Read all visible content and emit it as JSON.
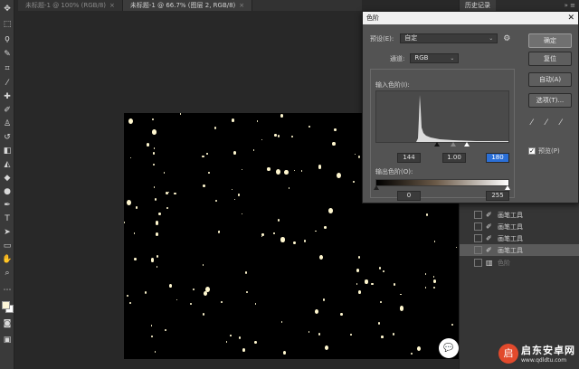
{
  "tabs": [
    {
      "label": "未标题-1 @ 100% (RGB/8)",
      "close": "×"
    },
    {
      "label": "未标题-1 @ 66.7% (图层 2, RGB/8)",
      "close": "×"
    }
  ],
  "history_panel": {
    "title": "历史记录",
    "controls": "»  ≡",
    "items": [
      {
        "label": "画笔工具"
      },
      {
        "label": "画笔工具"
      },
      {
        "label": "画笔工具"
      },
      {
        "label": "画笔工具"
      },
      {
        "label": "色阶"
      }
    ]
  },
  "levels_dialog": {
    "title": "色阶",
    "close": "✕",
    "preset_label": "预设(E):",
    "preset_value": "自定",
    "channel_label": "通道:",
    "channel_value": "RGB",
    "input_levels_label": "输入色阶(I):",
    "input_black": "144",
    "input_gamma": "1.00",
    "input_white": "180",
    "output_levels_label": "输出色阶(O):",
    "output_black": "0",
    "output_white": "255",
    "buttons": {
      "ok": "确定",
      "reset": "复位",
      "auto": "自动(A)",
      "options": "选项(T)..."
    },
    "preview_label": "预览(P)",
    "preview_checked": true
  },
  "watermark": {
    "main": "启东安卓网",
    "sub": "www.qdldtu.com"
  },
  "icons": {
    "gear": "gear-icon",
    "eyedropper": "eyedropper-icon",
    "brush": "brush-icon",
    "wechat": "wechat-icon"
  },
  "colors": {
    "foreground": "#fdf6d8",
    "background": "#ffffff",
    "canvas": "#000000",
    "star": "#fff7cf",
    "active_field": "#2b6fd6"
  }
}
